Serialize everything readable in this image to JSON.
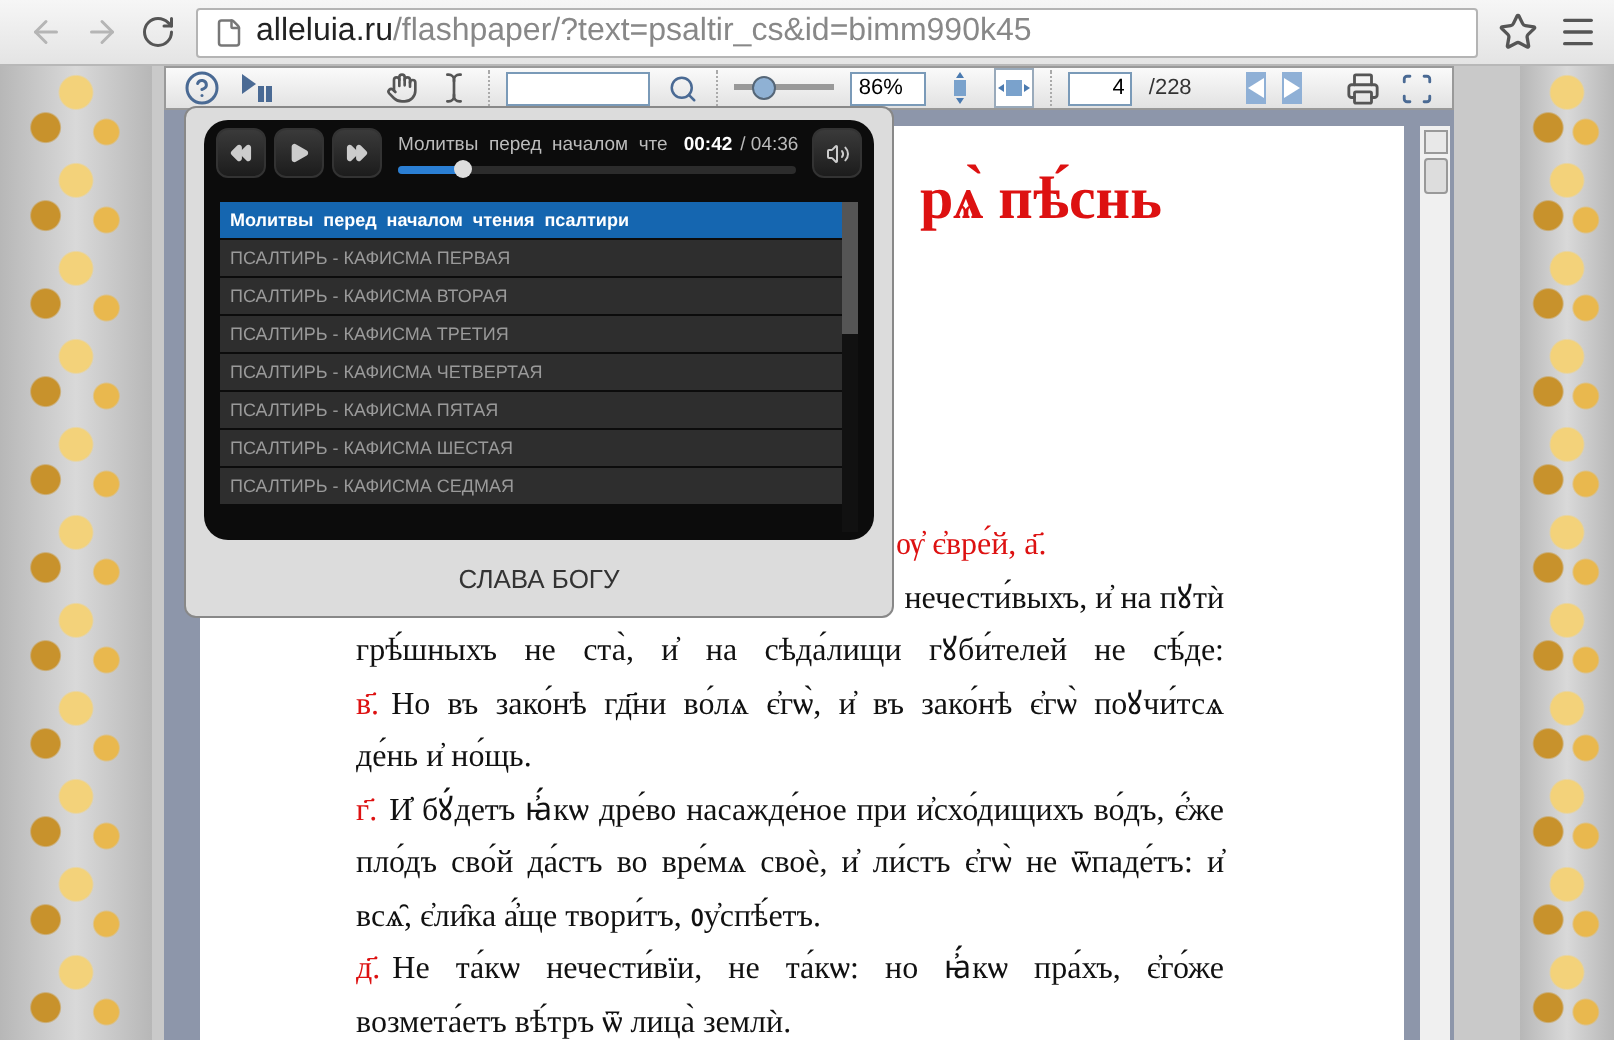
{
  "browser": {
    "url_domain": "alleluia.ru",
    "url_path": "/flashpaper/?text=psaltir_cs&id=bimm990k45"
  },
  "toolbar": {
    "zoom": {
      "level": 0.3,
      "reading": "86%"
    },
    "fit_modes": [
      {
        "kind": "page",
        "selected": false
      },
      {
        "kind": "width",
        "selected": true
      }
    ],
    "page": {
      "value": "4",
      "total": "/228"
    }
  },
  "player": {
    "track_title": "Молитвы  перед  началом  чте",
    "elapsed": "00:42",
    "duration": "/ 04:36",
    "progress": {
      "level": 0.16
    },
    "playlist": [
      {
        "label": "Молитвы  перед  началом  чтения  псалтири",
        "selected": true
      },
      {
        "label": "ПСАЛТИРЬ - КАФИСМА ПЕРВАЯ",
        "selected": false
      },
      {
        "label": "ПСАЛТИРЬ - КАФИСМА ВТОРАЯ",
        "selected": false
      },
      {
        "label": "ПСАЛТИРЬ - КАФИСМА ТРЕТИЯ",
        "selected": false
      },
      {
        "label": "ПСАЛТИРЬ - КАФИСМА ЧЕТВЕРТАЯ",
        "selected": false
      },
      {
        "label": "ПСАЛТИРЬ - КАФИСМА ПЯТАЯ",
        "selected": false
      },
      {
        "label": "ПСАЛТИРЬ - КАФИСМА ШЕСТАЯ",
        "selected": false
      },
      {
        "label": "ПСАЛТИРЬ - КАФИСМА СЕДМАЯ",
        "selected": false
      }
    ],
    "caption": "СЛАВА БОГУ"
  },
  "document": {
    "heading": "рѧ̀ пѣ́снь",
    "lines": [
      {
        "kind": "subtitle",
        "text": "ѹ҆ є҆вре́й, а҃."
      },
      {
        "kind": "tail",
        "text": "нечести́выхъ, и҆ на пꙋтѝ"
      },
      {
        "kind": "justified",
        "text": "грѣ́шныхъ не ста̀, и҆ на сѣда́лищи гꙋби́телей не сѣ́де:"
      },
      {
        "kind": "justified",
        "verse": "в҃.",
        "text": "Но въ зако́нѣ гд҃ни во́лѧ є҆гѡ̀, и҆ въ зако́нѣ є҆гѡ̀ поꙋчи́тсѧ"
      },
      {
        "kind": "last",
        "text": "де́нь и҆ но́щь."
      },
      {
        "kind": "justified",
        "verse": "г҃.",
        "text": "И҆ бꙋ́детъ ꙗ҆́кѡ дре́во насажде́ное при и҆схо́дищихъ во́дъ, є҆́же"
      },
      {
        "kind": "justified",
        "text": "пло́дъ сво́й да́стъ во вре́мѧ своѐ, и҆ ли́стъ є҆гѡ̀ не ѿпаде́тъ: и҆"
      },
      {
        "kind": "last",
        "text": "всѧ̑, є҆ли̑ка а҆́ще твори́тъ, ᲂу҆спѣ́етъ."
      },
      {
        "kind": "justified",
        "verse": "д҃.",
        "text": "Не та́кѡ нечести́вїи, не та́кѡ: но ꙗ҆́кѡ пра́хъ, є҆го́же"
      },
      {
        "kind": "last",
        "text": "возмета́етъ вѣ́тръ ѿ лица̀ землѝ."
      }
    ]
  }
}
